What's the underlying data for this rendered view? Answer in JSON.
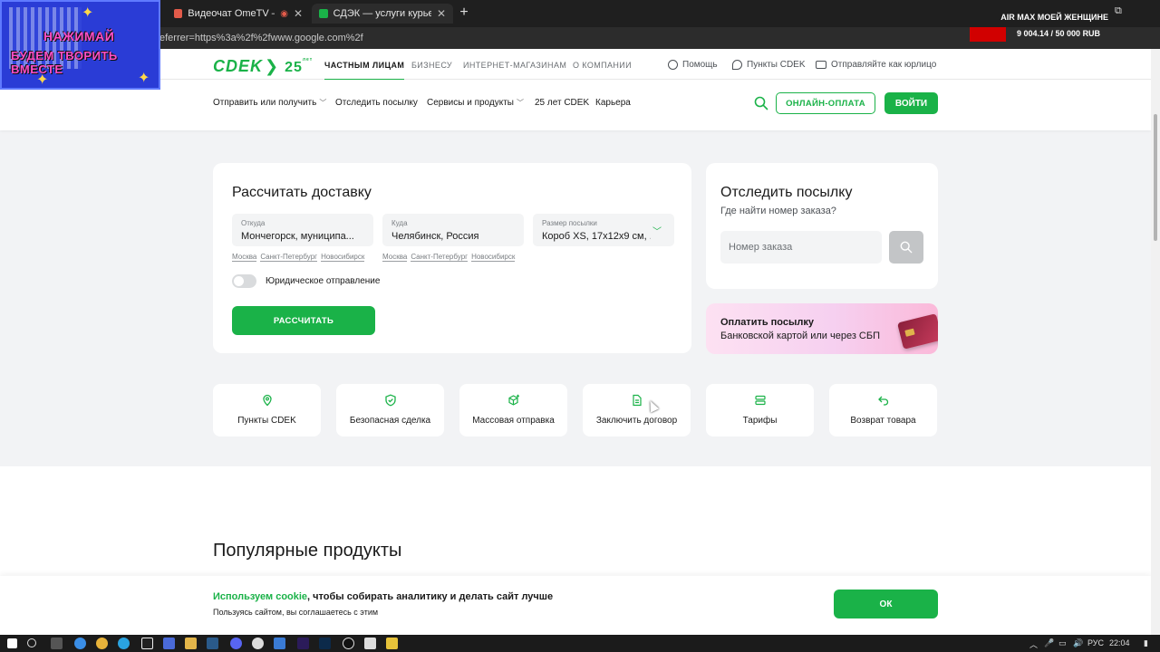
{
  "browser": {
    "tabs": [
      {
        "title": "Видеочат OmeTV — альте",
        "active": false
      },
      {
        "title": "СДЭК — услуги курьерской с",
        "active": true
      }
    ],
    "address": "eferrer=https%3a%2f%2fwww.google.com%2f"
  },
  "overlays": {
    "badge_line1": "НАЖИМАЙ",
    "badge_line2": "БУДЕМ ТВОРИТЬ ВМЕСТЕ",
    "goal_title": "AIR MAX МОЕЙ ЖЕНЩИНЕ",
    "goal_amount": "9 004.14 / 50 000 RUB"
  },
  "topnav": {
    "logo_text": "CDEK",
    "logo_years": "25",
    "logo_years_suffix": "лет",
    "segments": [
      "ЧАСТНЫМ ЛИЦАМ",
      "БИЗНЕСУ",
      "ИНТЕРНЕТ-МАГАЗИНАМ",
      "О КОМПАНИИ"
    ],
    "links": [
      "Помощь",
      "Пункты CDEK",
      "Отправляйте как юрлицо"
    ]
  },
  "mainnav": {
    "items": [
      "Отправить или получить",
      "Отследить посылку",
      "Сервисы и продукты",
      "25 лет CDEK",
      "Карьера"
    ],
    "online_pay": "ОНЛАЙН-ОПЛАТА",
    "login": "ВОЙТИ"
  },
  "calc": {
    "title": "Рассчитать доставку",
    "from_label": "Откуда",
    "from_value": "Мончегорск, муниципа...",
    "to_label": "Куда",
    "to_value": "Челябинск, Россия",
    "size_label": "Размер посылки",
    "size_value": "Короб XS, 17x12x9 см, ...",
    "quick_cities": [
      "Москва",
      "Санкт-Петербург",
      "Новосибирск"
    ],
    "legal_label": "Юридическое отправление",
    "button": "РАССЧИТАТЬ"
  },
  "track": {
    "title": "Отследить посылку",
    "subtitle": "Где найти номер заказа?",
    "placeholder": "Номер заказа"
  },
  "pay": {
    "title": "Оплатить посылку",
    "subtitle": "Банковской картой или через СБП"
  },
  "services": [
    "Пункты CDEK",
    "Безопасная сделка",
    "Массовая отправка",
    "Заключить договор",
    "Тарифы",
    "Возврат товара"
  ],
  "popular_title": "Популярные продукты",
  "cookie": {
    "highlight": "Используем cookie",
    "text": ", чтобы собирать аналитику и делать сайт лучше",
    "sub": "Пользуясь сайтом, вы соглашаетесь с этим",
    "ok": "ОК"
  },
  "taskbar": {
    "lang": "РУС",
    "time": "22:04"
  },
  "colors": {
    "brand_green": "#1ab248"
  }
}
